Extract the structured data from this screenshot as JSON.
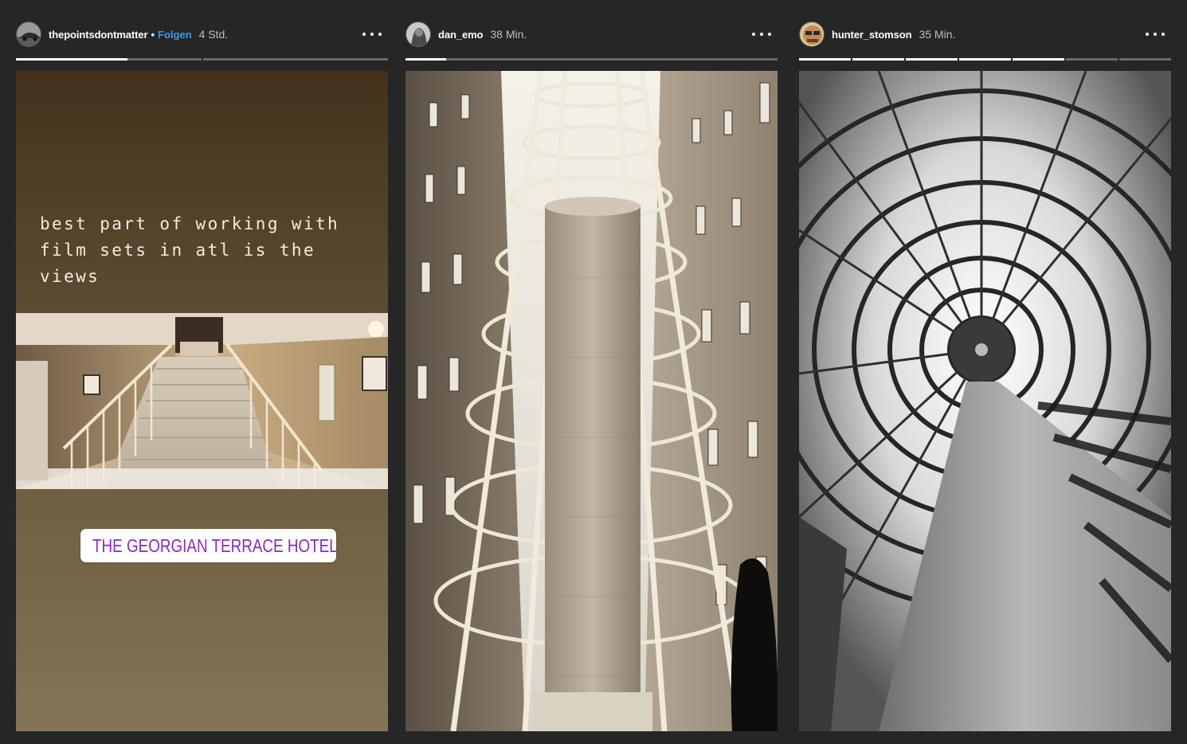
{
  "stories": [
    {
      "username": "thepointsdontmatter",
      "separator": "•",
      "follow_label": "Folgen",
      "time": "4 Std.",
      "more_icon": "more-horizontal-icon",
      "progress": [
        0.6,
        0
      ],
      "text_overlay": "best part of working with\nfilm sets in atl is the\nviews",
      "location_sticker": "THE GEORGIAN TERRACE HOTEL"
    },
    {
      "username": "dan_emo",
      "time": "38 Min.",
      "more_icon": "more-horizontal-icon",
      "progress": [
        0.11
      ]
    },
    {
      "username": "hunter_stomson",
      "time": "35 Min.",
      "more_icon": "more-horizontal-icon",
      "progress": [
        1,
        1,
        1,
        1,
        1,
        0,
        0
      ]
    }
  ],
  "colors": {
    "background": "#262626",
    "follow": "#3897f0",
    "sticker_text": "#8a2bb8"
  }
}
